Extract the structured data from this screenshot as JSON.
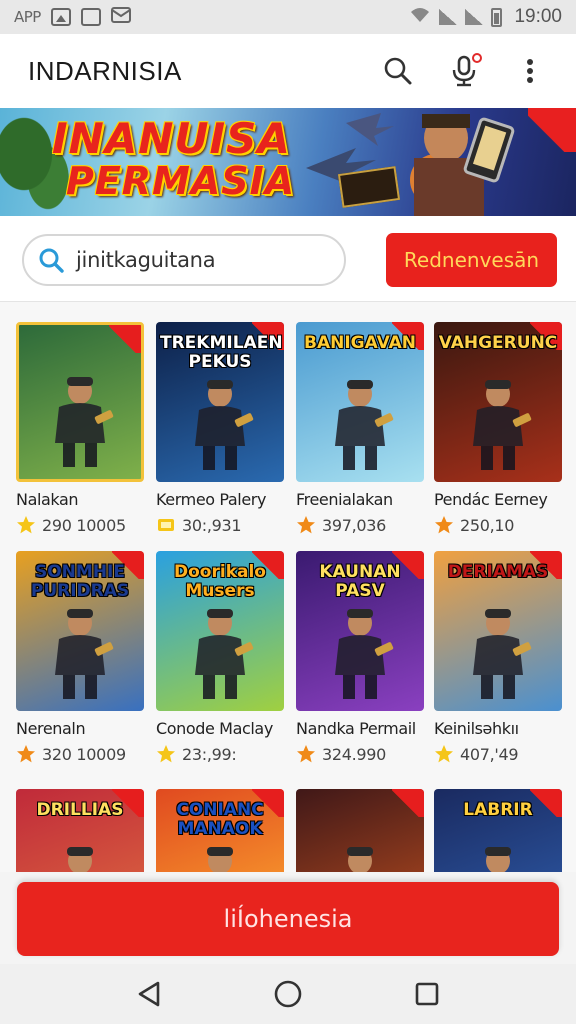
{
  "status_bar": {
    "app_label": "APP",
    "time": "19:00"
  },
  "app_bar": {
    "title": "INDARNISIA",
    "icons": [
      "search-icon",
      "mic-icon",
      "more-vert-icon"
    ],
    "mic_badge_color": "#e12a2a"
  },
  "banner": {
    "line1": "INANUISA",
    "line2": "PERMASIA"
  },
  "search": {
    "value": "jinitkaguitana"
  },
  "redeem_button": {
    "label": "Rednenvesān"
  },
  "games": [
    {
      "name": "Nalakan",
      "rating": "290 10005",
      "title_art": "",
      "star": "yellow",
      "palette": [
        "#2d6a3a",
        "#7fb04a"
      ],
      "title_color": "#ffd24a"
    },
    {
      "name": "Kermeo Palery",
      "rating": "30:,931",
      "title_art": "TREKMILAEN PEKUS",
      "star": "yellow-box",
      "palette": [
        "#0d2048",
        "#2a6ab0"
      ],
      "title_color": "#ffffff"
    },
    {
      "name": "Freenialakan",
      "rating": "397,036",
      "title_art": "BANIGAVAN",
      "star": "orange",
      "palette": [
        "#4a9ad0",
        "#a8e0f0"
      ],
      "title_color": "#ffcc33"
    },
    {
      "name": "Pendác Eerney",
      "rating": "250,10",
      "title_art": "VAHGERUNC",
      "star": "orange",
      "palette": [
        "#3a1810",
        "#a8301a"
      ],
      "title_color": "#ffd24a"
    },
    {
      "name": "Nerenaln",
      "rating": "320 10009",
      "title_art": "SONMHIE PURIDRAS",
      "star": "orange",
      "palette": [
        "#e8a020",
        "#3870c0"
      ],
      "title_color": "#1a3a90"
    },
    {
      "name": "Conode Maclay",
      "rating": "23:,99:",
      "title_art": "Doorikalo Musers",
      "star": "yellow",
      "palette": [
        "#2aa0e0",
        "#a0d040"
      ],
      "title_color": "#ffb020"
    },
    {
      "name": "Nandka Permail",
      "rating": "324.990",
      "title_art": "KAUNAN PASV",
      "star": "orange",
      "palette": [
        "#3a1a70",
        "#8a40c0"
      ],
      "title_color": "#ffe060"
    },
    {
      "name": "Keinilsəhkıı",
      "rating": "407,'49",
      "title_art": "DERIAMAS",
      "star": "yellow",
      "palette": [
        "#f0a040",
        "#4a90d0"
      ],
      "title_color": "#c01818"
    },
    {
      "name": "",
      "rating": "",
      "title_art": "DRILLIAS",
      "star": "",
      "palette": [
        "#c02a3a",
        "#e07040"
      ],
      "title_color": "#ffe060"
    },
    {
      "name": "",
      "rating": "",
      "title_art": "CONIANC MANAOK",
      "star": "",
      "palette": [
        "#e04a20",
        "#ffb030"
      ],
      "title_color": "#1a50c0"
    },
    {
      "name": "",
      "rating": "",
      "title_art": "",
      "star": "",
      "palette": [
        "#401818",
        "#c05020"
      ],
      "title_color": "#ffffff"
    },
    {
      "name": "",
      "rating": "",
      "title_art": "LABRIR",
      "star": "",
      "palette": [
        "#1a2a60",
        "#3060b0"
      ],
      "title_color": "#ffd040"
    }
  ],
  "primary_action": {
    "label": "liÍohenesia"
  },
  "colors": {
    "accent_red": "#e8221d",
    "redeem_text": "#ffd85a",
    "star_yellow": "#f5c518",
    "star_orange": "#f08a18"
  }
}
